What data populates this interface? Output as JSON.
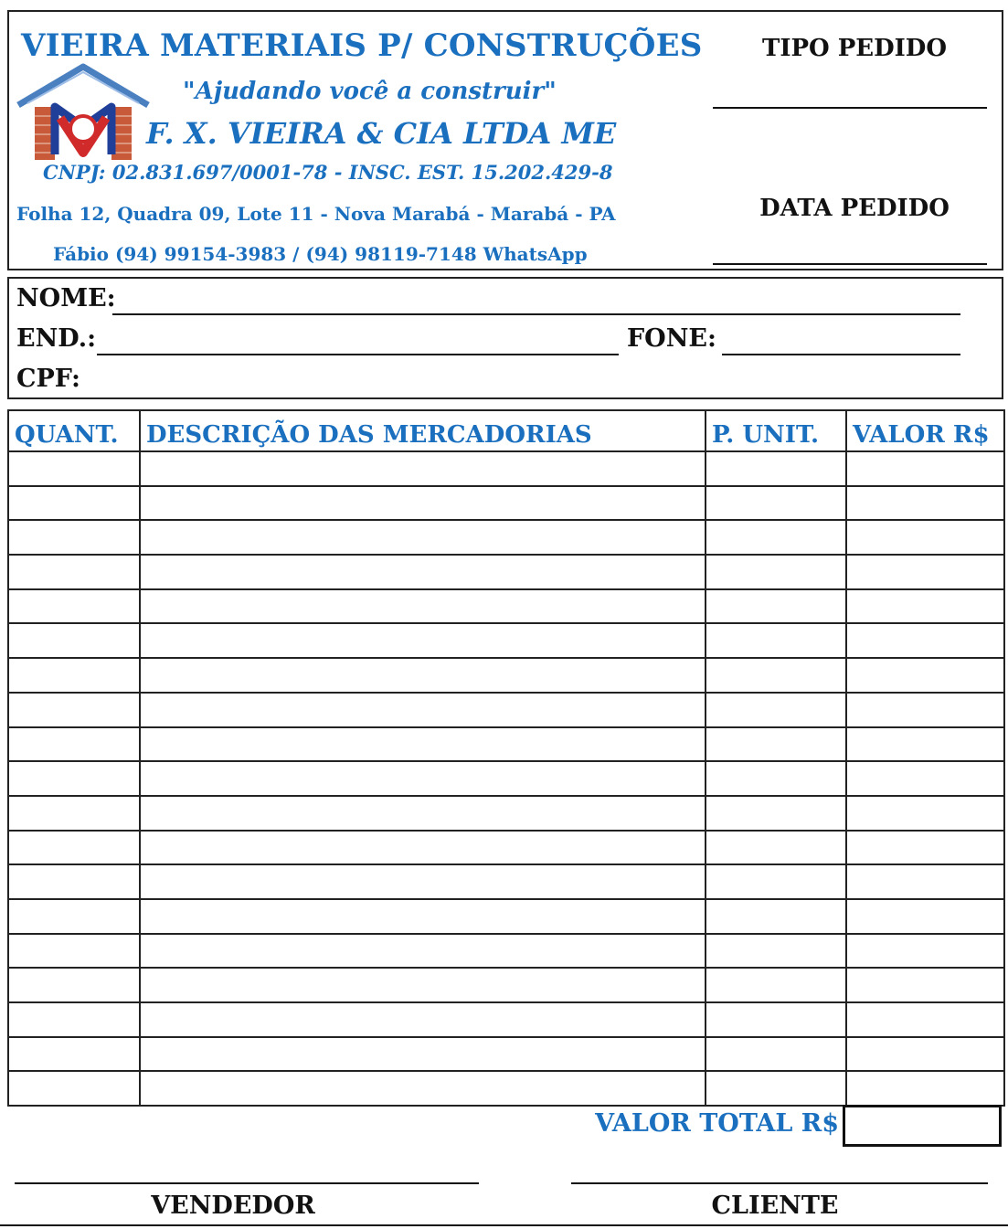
{
  "header": {
    "company_name": "VIEIRA MATERIAIS P/ CONSTRUÇÕES",
    "slogan": "\"Ajudando você a construir\"",
    "legal_name": "F. X. VIEIRA & CIA LTDA ME",
    "cnpj": "CNPJ: 02.831.697/0001-78 - INSC. EST. 15.202.429-8",
    "address": "Folha 12, Quadra 09, Lote 11 - Nova Marabá - Marabá - PA",
    "phone": "Fábio (94) 99154-3983 / (94) 98119-7148 WhatsApp",
    "order_type_label": "TIPO PEDIDO",
    "order_date_label": "DATA PEDIDO"
  },
  "logo": {
    "icon": "house-vm-logo",
    "colors": {
      "roof": "#4a7fc0",
      "v": "#d12a2a",
      "m": "#1f3f99",
      "brick": "#c85a3a"
    }
  },
  "customer": {
    "name_label": "NOME:",
    "address_label": "END.:",
    "phone_label": "FONE:",
    "cpf_label": "CPF:"
  },
  "table": {
    "headers": [
      "QUANT.",
      "DESCRIÇÃO DAS MERCADORIAS",
      "P. UNIT.",
      "VALOR R$"
    ]
  },
  "total": {
    "label": "VALOR TOTAL R$"
  },
  "signatures": {
    "seller": "VENDEDOR",
    "client": "CLIENTE"
  },
  "colors": {
    "accent": "#1a6fbf",
    "ink": "#111111"
  }
}
